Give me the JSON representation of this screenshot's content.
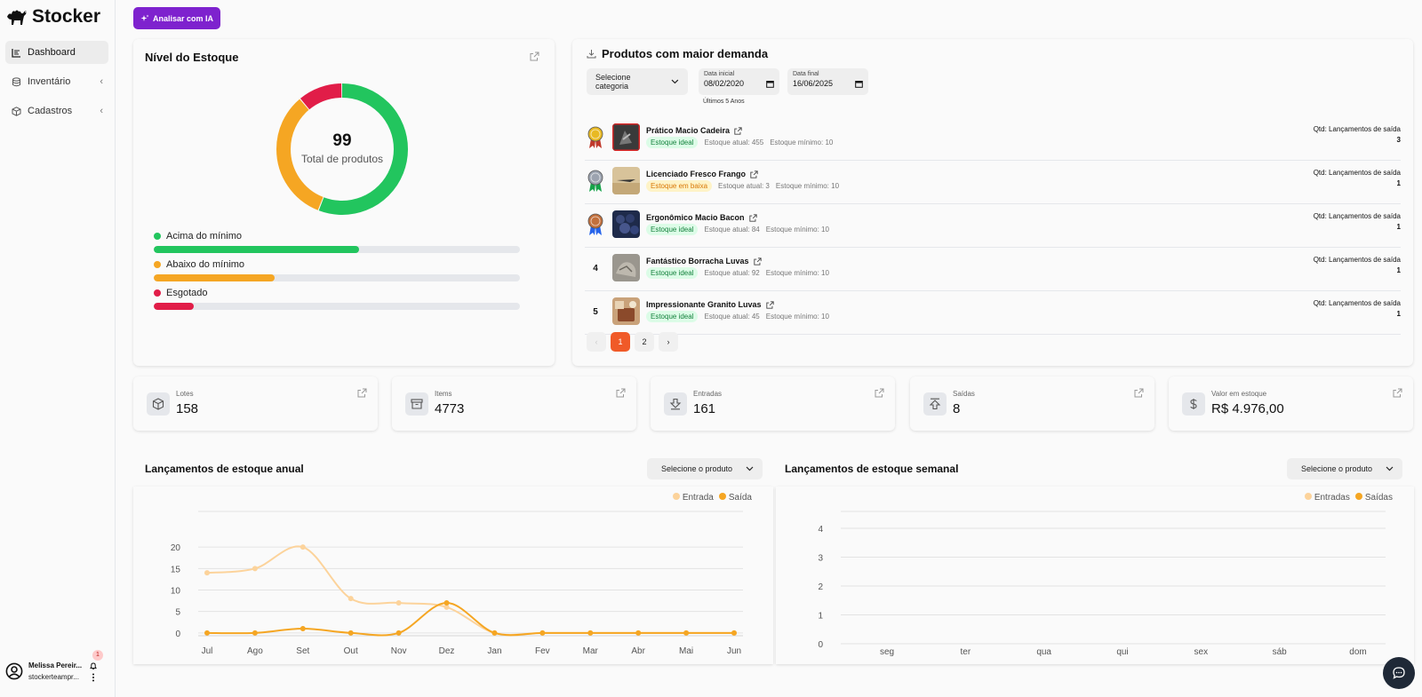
{
  "app": {
    "name": "Stocker"
  },
  "sidebar": {
    "items": [
      {
        "label": "Dashboard",
        "icon": "dashboard-icon",
        "active": true
      },
      {
        "label": "Inventário",
        "icon": "database-icon",
        "active": false
      },
      {
        "label": "Cadastros",
        "icon": "box-icon",
        "active": false
      }
    ],
    "user": {
      "name": "Melissa Pereir...",
      "email": "stockerteampr...",
      "notifications": "1"
    }
  },
  "ai_button": {
    "label": "Analisar com IA"
  },
  "stock_level": {
    "title": "Nível do Estoque",
    "total": "99",
    "total_label": "Total de produtos",
    "segments": [
      {
        "label": "Acima do mínimo",
        "fraction": 0.56,
        "color": "#22c55e"
      },
      {
        "label": "Abaixo do mínimo",
        "fraction": 0.33,
        "color": "#f5a623"
      },
      {
        "label": "Esgotado",
        "fraction": 0.11,
        "color": "#e11d48"
      }
    ]
  },
  "products": {
    "title": "Produtos com maior demanda",
    "category_placeholder": "Selecione categoria",
    "start_label": "Data inicial",
    "start_value": "08/02/2020",
    "end_label": "Data final",
    "end_value": "16/06/2025",
    "range_hint": "Últimos 5 Anos",
    "qty_label": "Qtd: Lançamentos de saída",
    "items": [
      {
        "rank": "1",
        "medal": "gold",
        "name": "Prático Macio Cadeira",
        "status": "Estoque ideal",
        "status_type": "ok",
        "current": "Estoque atual: 455",
        "minimum": "Estoque mínimo: 10",
        "qty": "3",
        "thumb": "chair"
      },
      {
        "rank": "2",
        "medal": "silver",
        "name": "Licenciado Fresco Frango",
        "status": "Estoque em baixa",
        "status_type": "low",
        "current": "Estoque atual: 3",
        "minimum": "Estoque mínimo: 10",
        "qty": "1",
        "thumb": "plane"
      },
      {
        "rank": "3",
        "medal": "bronze",
        "name": "Ergonômico Macio Bacon",
        "status": "Estoque ideal",
        "status_type": "ok",
        "current": "Estoque atual: 84",
        "minimum": "Estoque mínimo: 10",
        "qty": "1",
        "thumb": "berries"
      },
      {
        "rank": "4",
        "medal": "",
        "name": "Fantástico Borracha Luvas",
        "status": "Estoque ideal",
        "status_type": "ok",
        "current": "Estoque atual: 92",
        "minimum": "Estoque mínimo: 10",
        "qty": "1",
        "thumb": "rock"
      },
      {
        "rank": "5",
        "medal": "",
        "name": "Impressionante Granito Luvas",
        "status": "Estoque ideal",
        "status_type": "ok",
        "current": "Estoque atual: 45",
        "minimum": "Estoque mínimo: 10",
        "qty": "1",
        "thumb": "bag"
      }
    ],
    "pagination": {
      "prev": "‹",
      "pages": [
        "1",
        "2"
      ],
      "current": "1",
      "next": "›"
    }
  },
  "kpis": [
    {
      "label": "Lotes",
      "value": "158",
      "icon": "box-icon"
    },
    {
      "label": "Items",
      "value": "4773",
      "icon": "archive-icon"
    },
    {
      "label": "Entradas",
      "value": "161",
      "icon": "arrow-down-icon"
    },
    {
      "label": "Saídas",
      "value": "8",
      "icon": "arrow-up-icon"
    },
    {
      "label": "Valor em estoque",
      "value": "R$ 4.976,00",
      "icon": "dollar-icon"
    }
  ],
  "annual_section": {
    "title": "Lançamentos de estoque anual",
    "select_placeholder": "Selecione o produto"
  },
  "weekly_section": {
    "title": "Lançamentos de estoque semanal",
    "select_placeholder": "Selecione o produto"
  },
  "chart_data": [
    {
      "type": "line",
      "categories": [
        "Jul",
        "Ago",
        "Set",
        "Out",
        "Nov",
        "Dez",
        "Jan",
        "Fev",
        "Mar",
        "Abr",
        "Mai",
        "Jun"
      ],
      "series": [
        {
          "name": "Entrada",
          "color": "#fcd39b",
          "values": [
            14,
            15,
            20,
            8,
            7,
            6,
            0,
            0,
            0,
            0,
            0,
            0
          ]
        },
        {
          "name": "Saída",
          "color": "#f5a623",
          "values": [
            0,
            0,
            1,
            0,
            0,
            7,
            0,
            0,
            0,
            0,
            0,
            0
          ]
        }
      ],
      "yticks": [
        0,
        5,
        10,
        15,
        20
      ],
      "ylim": [
        -5,
        25
      ],
      "grid": true,
      "legend": "top-right"
    },
    {
      "type": "line",
      "categories": [
        "seg",
        "ter",
        "qua",
        "qui",
        "sex",
        "sáb",
        "dom"
      ],
      "series": [
        {
          "name": "Entradas",
          "color": "#fcd39b",
          "values": []
        },
        {
          "name": "Saídas",
          "color": "#f5a623",
          "values": []
        }
      ],
      "yticks": [
        0,
        1,
        2,
        3,
        4
      ],
      "ylim": [
        0,
        4.4
      ],
      "grid": true,
      "legend": "top-right"
    }
  ]
}
